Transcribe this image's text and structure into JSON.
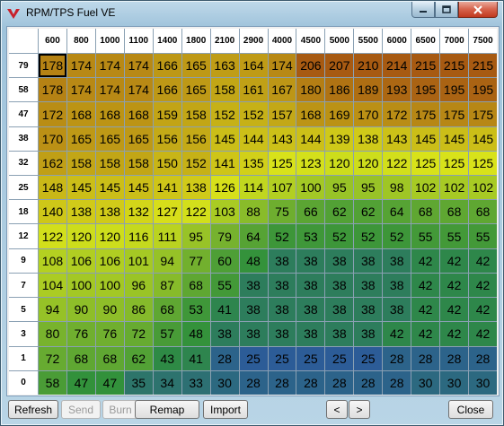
{
  "window": {
    "title": "RPM/TPS Fuel VE"
  },
  "colors": {
    "low": "#2b4fae",
    "mid_low": "#2e8f3c",
    "mid": "#d8e21a",
    "high": "#a75a12"
  },
  "table": {
    "rpm": [
      "600",
      "800",
      "1000",
      "1100",
      "1400",
      "1800",
      "2100",
      "2900",
      "4000",
      "4500",
      "5000",
      "5500",
      "6000",
      "6500",
      "7000",
      "7500"
    ],
    "tps": [
      "79",
      "58",
      "47",
      "38",
      "32",
      "25",
      "18",
      "12",
      "9",
      "7",
      "5",
      "3",
      "1",
      "0"
    ],
    "selected": {
      "row": 0,
      "col": 0
    },
    "values": [
      [
        178,
        174,
        174,
        174,
        166,
        165,
        163,
        164,
        174,
        206,
        207,
        210,
        214,
        215,
        215,
        215
      ],
      [
        178,
        174,
        174,
        174,
        166,
        165,
        158,
        161,
        167,
        180,
        186,
        189,
        193,
        195,
        195,
        195
      ],
      [
        172,
        168,
        168,
        168,
        159,
        158,
        152,
        152,
        157,
        168,
        169,
        170,
        172,
        175,
        175,
        175
      ],
      [
        170,
        165,
        165,
        165,
        156,
        156,
        145,
        144,
        143,
        144,
        139,
        138,
        143,
        145,
        145,
        145
      ],
      [
        162,
        158,
        158,
        158,
        150,
        152,
        141,
        135,
        125,
        123,
        120,
        120,
        122,
        125,
        125,
        125
      ],
      [
        148,
        145,
        145,
        145,
        141,
        138,
        126,
        114,
        107,
        100,
        95,
        95,
        98,
        102,
        102,
        102
      ],
      [
        140,
        138,
        138,
        132,
        127,
        122,
        103,
        88,
        75,
        66,
        62,
        62,
        64,
        68,
        68,
        68
      ],
      [
        122,
        120,
        120,
        116,
        111,
        95,
        79,
        64,
        52,
        53,
        52,
        52,
        52,
        55,
        55,
        55
      ],
      [
        108,
        106,
        106,
        101,
        94,
        77,
        60,
        48,
        38,
        38,
        38,
        38,
        38,
        42,
        42,
        42
      ],
      [
        104,
        100,
        100,
        96,
        87,
        68,
        55,
        38,
        38,
        38,
        38,
        38,
        38,
        42,
        42,
        42
      ],
      [
        94,
        90,
        90,
        86,
        68,
        53,
        41,
        38,
        38,
        38,
        38,
        38,
        38,
        42,
        42,
        42
      ],
      [
        80,
        76,
        76,
        72,
        57,
        48,
        38,
        38,
        38,
        38,
        38,
        38,
        42,
        42,
        42,
        42
      ],
      [
        72,
        68,
        68,
        62,
        43,
        41,
        28,
        25,
        25,
        25,
        25,
        25,
        28,
        28,
        28,
        28
      ],
      [
        58,
        47,
        47,
        35,
        34,
        33,
        30,
        28,
        28,
        28,
        28,
        28,
        28,
        30,
        30,
        30
      ]
    ]
  },
  "buttons": {
    "refresh": "Refresh",
    "send": "Send",
    "burn": "Burn",
    "remap": "Remap",
    "import": "Import",
    "prev": "<",
    "next": ">",
    "close": "Close"
  }
}
